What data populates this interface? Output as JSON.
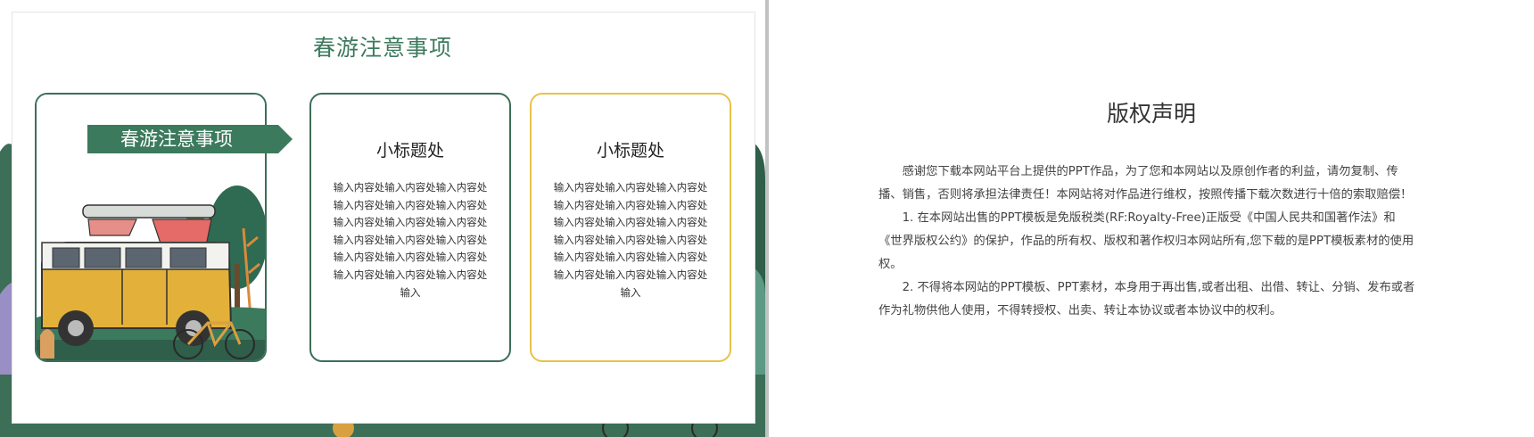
{
  "left_slide": {
    "title": "春游注意事项",
    "ribbon_label": "春游注意事项",
    "cards": [
      {
        "heading": "小标题处",
        "body": "输入内容处输入内容处输入内容处输入内容处输入内容处输入内容处输入内容处输入内容处输入内容处输入内容处输入内容处输入内容处输入内容处输入内容处输入内容处输入内容处输入内容处输入内容处输入"
      },
      {
        "heading": "小标题处",
        "body": "输入内容处输入内容处输入内容处输入内容处输入内容处输入内容处输入内容处输入内容处输入内容处输入内容处输入内容处输入内容处输入内容处输入内容处输入内容处输入内容处输入内容处输入内容处输入"
      }
    ],
    "colors": {
      "accent_green": "#3c7a5d",
      "border_green": "#3c6e58",
      "border_yellow": "#e8c24a"
    }
  },
  "right_slide": {
    "title": "版权声明",
    "paragraphs": [
      "感谢您下载本网站平台上提供的PPT作品，为了您和本网站以及原创作者的利益，请勿复制、传播、销售，否则将承担法律责任！本网站将对作品进行维权，按照传播下载次数进行十倍的索取赔偿！",
      "1. 在本网站出售的PPT模板是免版税类(RF:Royalty-Free)正版受《中国人民共和国著作法》和《世界版权公约》的保护，作品的所有权、版权和著作权归本网站所有,您下载的是PPT模板素材的使用权。",
      "2. 不得将本网站的PPT模板、PPT素材，本身用于再出售,或者出租、出借、转让、分销、发布或者作为礼物供他人使用，不得转授权、出卖、转让本协议或者本协议中的权利。"
    ]
  }
}
